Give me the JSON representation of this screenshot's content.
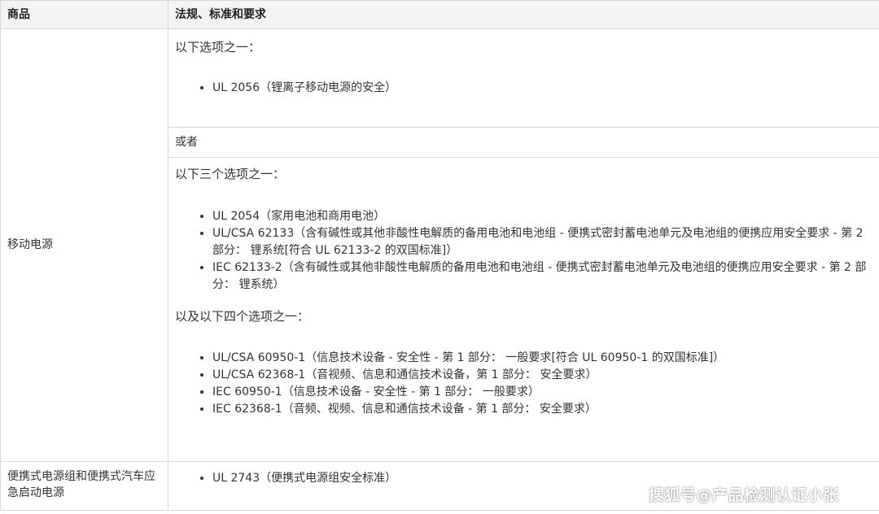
{
  "table": {
    "headers": [
      "商品",
      "法规、标准和要求"
    ],
    "power_bank": {
      "product": "移动电源",
      "option1_intro": "以下选项之一：",
      "option1_items": [
        "UL 2056（锂离子移动电源的安全）"
      ],
      "or_text": "或者",
      "option2_intro": "以下三个选项之一：",
      "option2_items": [
        "UL 2054（家用电池和商用电池）",
        "UL/CSA 62133（含有碱性或其他非酸性电解质的备用电池和电池组 - 便携式密封蓄电池单元及电池组的便携应用安全要求 - 第 2 部分： 锂系统[符合 UL 62133-2 的双国标准]）",
        "IEC 62133-2（含有碱性或其他非酸性电解质的备用电池和电池组 - 便携式密封蓄电池单元及电池组的便携应用安全要求 - 第 2 部分： 锂系统）"
      ],
      "option3_intro": "以及以下四个选项之一：",
      "option3_items": [
        "UL/CSA 60950-1（信息技术设备 - 安全性 - 第 1 部分： 一般要求[符合 UL 60950-1 的双国标准]）",
        "UL/CSA 62368-1（音视频、信息和通信技术设备，第 1 部分： 安全要求）",
        "IEC 60950-1（信息技术设备 - 安全性 - 第 1 部分： 一般要求）",
        "IEC 62368-1（音频、视频、信息和通信技术设备 - 第 1 部分： 安全要求）"
      ]
    },
    "portable_pack": {
      "product": "便携式电源组和便携式汽车应急启动电源",
      "items": [
        "UL 2743（便携式电源组安全标准）"
      ]
    }
  },
  "watermark": "搜狐号@产品检测认证小张"
}
